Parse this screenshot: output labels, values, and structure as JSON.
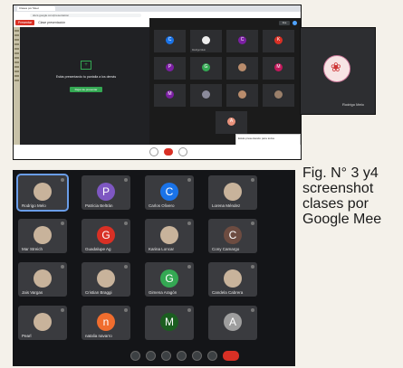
{
  "top_screenshot": {
    "tab_title": "Clases por Meet",
    "url": "docs.google.com/presentation",
    "doc_button": "Presentar",
    "doc_title": "Clase presentación",
    "present_text": "Estás presentando tu pantalla a los demás",
    "present_button": "Dejar de presentar",
    "header_button": "Rea",
    "tiles": [
      {
        "initial": "C",
        "name": "",
        "color": "#1a73e8"
      },
      {
        "initial": "",
        "name": "Rodrigo Melo",
        "color": "#eeeeee"
      },
      {
        "initial": "C",
        "name": "",
        "color": "#7b1fa2"
      },
      {
        "initial": "K",
        "name": "",
        "color": "#d93025"
      },
      {
        "initial": "P",
        "name": "",
        "color": "#7b1fa2"
      },
      {
        "initial": "G",
        "name": "",
        "color": "#34a853"
      },
      {
        "initial": "",
        "name": "",
        "color": "#b98c6c"
      },
      {
        "initial": "M",
        "name": "",
        "color": "#c2185b"
      },
      {
        "initial": "M",
        "name": "",
        "color": "#7b1fa2"
      },
      {
        "initial": "",
        "name": "",
        "color": "#8a8a9a"
      },
      {
        "initial": "",
        "name": "",
        "color": "#b98c6c"
      },
      {
        "initial": "",
        "name": "",
        "color": "#9a7f6a"
      },
      {
        "initial": "A",
        "name": "",
        "color": "#e8927c"
      }
    ],
    "notification": "Estás presentando para todos",
    "side_name": "Rodrigo Melo"
  },
  "bottom_screenshot": {
    "tiles": [
      {
        "initial": "",
        "name": "Rodrigo Melo",
        "color": "",
        "photo": true,
        "selected": true
      },
      {
        "initial": "P",
        "name": "Patricia Beltrán",
        "color": "#7e57c2",
        "photo": false
      },
      {
        "initial": "C",
        "name": "Carlos Olivero",
        "color": "#1a73e8",
        "photo": false
      },
      {
        "initial": "",
        "name": "Lorena Méndez",
        "color": "",
        "photo": true
      },
      {
        "initial": "",
        "name": "Mar Streich",
        "color": "",
        "photo": true
      },
      {
        "initial": "G",
        "name": "Guadalupe Ag",
        "color": "#d93025",
        "photo": false
      },
      {
        "initial": "",
        "name": "Karina Loncar",
        "color": "",
        "photo": true
      },
      {
        "initial": "C",
        "name": "Cony Camargo",
        "color": "#6d4c41",
        "photo": false
      },
      {
        "initial": "",
        "name": "Jais Vargas",
        "color": "",
        "photo": true
      },
      {
        "initial": "",
        "name": "Cristian Braggi",
        "color": "",
        "photo": true
      },
      {
        "initial": "G",
        "name": "Gimena Aragón",
        "color": "#34a853",
        "photo": false
      },
      {
        "initial": "",
        "name": "Candela Cabrera",
        "color": "",
        "photo": true
      },
      {
        "initial": "",
        "name": "Pearl",
        "color": "",
        "photo": true
      },
      {
        "initial": "n",
        "name": "natalia navarro",
        "color": "#f06d2e",
        "photo": false
      },
      {
        "initial": "M",
        "name": "",
        "color": "#1b5e20",
        "photo": true
      },
      {
        "initial": "A",
        "name": "",
        "color": "#9e9e9e",
        "photo": false
      }
    ]
  },
  "caption": {
    "line1": "Fig. N° 3 y4",
    "line2": "screenshot",
    "line3": "clases por",
    "line4": "Google Mee"
  }
}
